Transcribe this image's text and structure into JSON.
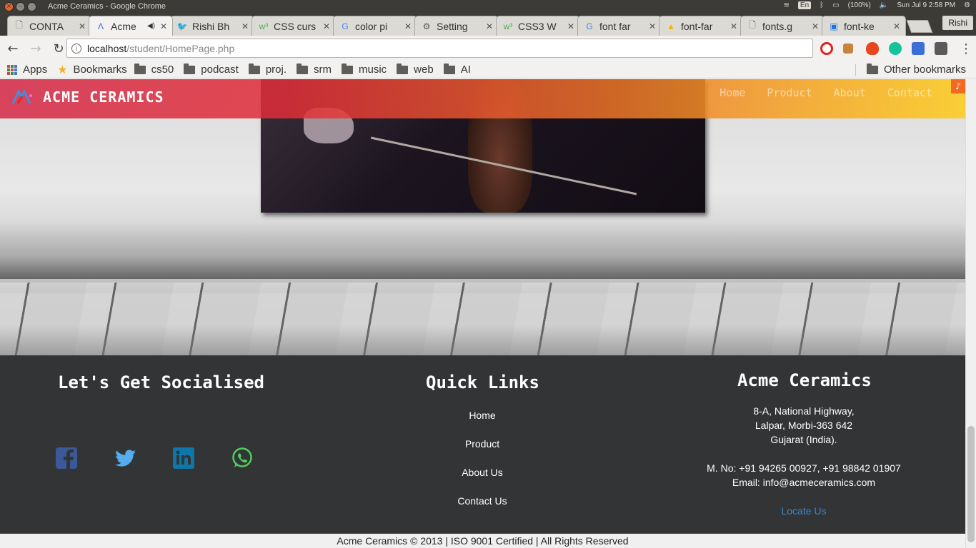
{
  "os": {
    "window_title": "Acme Ceramics - Google Chrome",
    "lang": "En",
    "battery": "(100%)",
    "datetime": "Sun Jul  9  2:58 PM"
  },
  "tabs": [
    {
      "title": "CONTA",
      "icon": "page-icon"
    },
    {
      "title": "Acme",
      "icon": "acme-logo-icon",
      "active": true
    },
    {
      "title": "Rishi Bh",
      "icon": "twitter-icon"
    },
    {
      "title": "CSS curs",
      "icon": "w3schools-icon"
    },
    {
      "title": "color pi",
      "icon": "google-icon"
    },
    {
      "title": "Setting",
      "icon": "gear-icon"
    },
    {
      "title": "CSS3 W",
      "icon": "w3schools-icon"
    },
    {
      "title": "font far",
      "icon": "google-icon"
    },
    {
      "title": "font-far",
      "icon": "drive-icon"
    },
    {
      "title": "fonts.g",
      "icon": "page-icon"
    },
    {
      "title": "font-ke",
      "icon": "chat-icon"
    }
  ],
  "profile": "Rishi",
  "address": {
    "host": "localhost",
    "path": "/student/HomePage.php"
  },
  "bookmarks": {
    "apps": "Apps",
    "bookmarks": "Bookmarks",
    "folders": [
      "cs50",
      "podcast",
      "proj.",
      "srm",
      "music",
      "web",
      "AI"
    ],
    "other": "Other bookmarks"
  },
  "site": {
    "brand": "ACME CERAMICS",
    "nav": [
      "Home",
      "Product",
      "About",
      "Contact"
    ],
    "music_icon": "music-note-icon"
  },
  "footer": {
    "social_title": "Let's Get Socialised",
    "social": [
      "facebook",
      "twitter",
      "linkedin",
      "whatsapp"
    ],
    "links_title": "Quick Links",
    "links": [
      "Home",
      "Product",
      "About Us",
      "Contact Us"
    ],
    "company_title": "Acme Ceramics",
    "address_lines": [
      "8-A, National Highway,",
      "Lalpar, Morbi-363 642",
      "Gujarat (India)."
    ],
    "phone": "M. No: +91 94265 00927, +91 98842 01907",
    "email": "Email: info@acmeceramics.com",
    "locate": "Locate Us",
    "copyright": "Acme Ceramics © 2013 | ISO 9001 Certified | All Rights Reserved"
  },
  "colors": {
    "footer_bg": "#333436",
    "link_blue": "#3a88c9",
    "facebook": "#3b5998",
    "twitter": "#55acee",
    "linkedin": "#0e76a8",
    "whatsapp": "#4fce5d"
  }
}
